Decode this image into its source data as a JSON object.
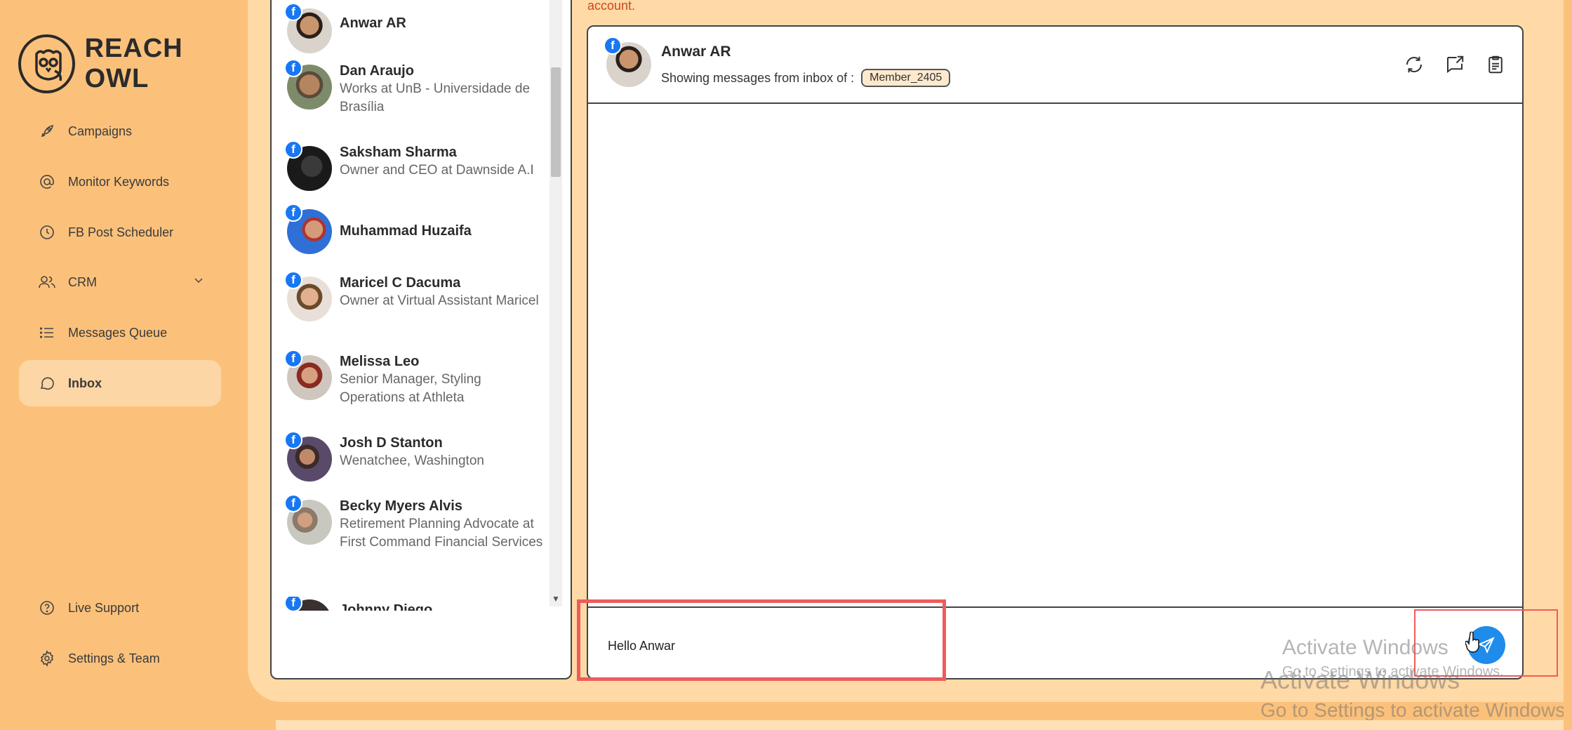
{
  "app": {
    "brand": "REACH OWL"
  },
  "sidebar": {
    "items": [
      {
        "label": "Campaigns",
        "icon": "rocket-icon"
      },
      {
        "label": "Monitor Keywords",
        "icon": "at-sign-icon"
      },
      {
        "label": "FB Post Scheduler",
        "icon": "clock-icon"
      },
      {
        "label": "CRM",
        "icon": "users-icon"
      },
      {
        "label": "Messages Queue",
        "icon": "list-icon"
      },
      {
        "label": "Inbox",
        "icon": "chat-bubble-icon",
        "active": true
      }
    ],
    "bottom": [
      {
        "label": "Live Support",
        "icon": "help-circle-icon"
      },
      {
        "label": "Settings & Team",
        "icon": "gear-icon"
      }
    ]
  },
  "notice": "account.",
  "contacts": [
    {
      "name": "Anwar AR",
      "sub": ""
    },
    {
      "name": "Dan Araujo",
      "sub": "Works at UnB - Universidade de Brasília"
    },
    {
      "name": "Saksham Sharma",
      "sub": "Owner and CEO at Dawnside A.I"
    },
    {
      "name": "Muhammad Huzaifa",
      "sub": ""
    },
    {
      "name": "Maricel C Dacuma",
      "sub": "Owner at Virtual Assistant Maricel"
    },
    {
      "name": "Melissa Leo",
      "sub": "Senior Manager, Styling Operations at Athleta"
    },
    {
      "name": "Josh D Stanton",
      "sub": "Wenatchee, Washington"
    },
    {
      "name": "Becky Myers Alvis",
      "sub": "Retirement Planning Advocate at First Command Financial Services"
    },
    {
      "name": "Johnny Diego",
      "sub": ""
    }
  ],
  "chat": {
    "name": "Anwar AR",
    "inbox_label": "Showing messages from inbox of :",
    "member": "Member_2405",
    "message_value": "Hello Anwar"
  },
  "watermark": {
    "line1": "Activate Windows",
    "line2": "Go to Settings to activate Windows.",
    "line3": "Activate Windows",
    "line4": "Go to Settings to activate Windows."
  },
  "colors": {
    "background": "#fbc17b",
    "panel": "#ffd9a6",
    "accent": "#1877f2",
    "send": "#1f8ceb",
    "highlight": "#ef5b5b"
  }
}
